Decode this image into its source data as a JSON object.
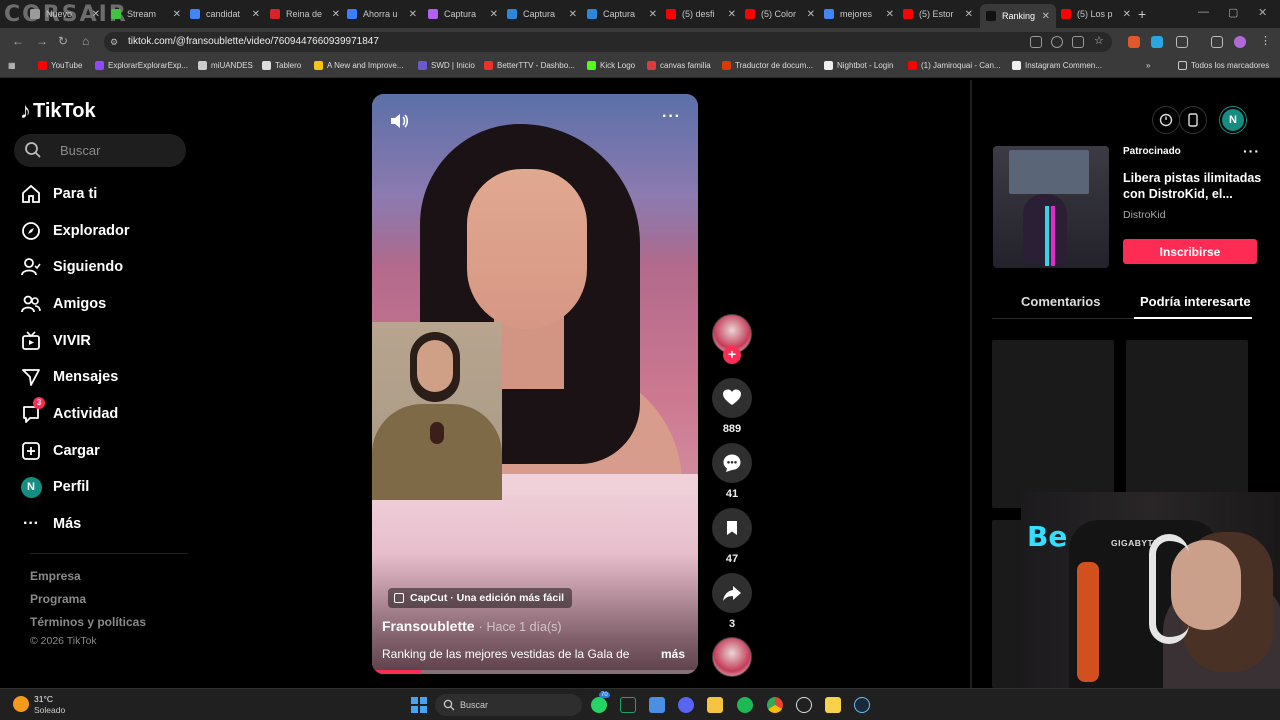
{
  "browser": {
    "watermark": "CORSAIR",
    "tabs": [
      {
        "title": "Nuevo",
        "color": "#9b9b9b"
      },
      {
        "title": "Stream",
        "color": "#3ec43e"
      },
      {
        "title": "candidat",
        "color": "#4285f4"
      },
      {
        "title": "Reina de",
        "color": "#d8232a"
      },
      {
        "title": "Ahorra u",
        "color": "#3d7eff"
      },
      {
        "title": "Captura",
        "color": "#b061f0"
      },
      {
        "title": "Captura",
        "color": "#2b88d8"
      },
      {
        "title": "Captura",
        "color": "#2b88d8"
      },
      {
        "title": "(5) desfi",
        "color": "#ff0000"
      },
      {
        "title": "(5) Color",
        "color": "#ff0000"
      },
      {
        "title": "mejores",
        "color": "#4285f4"
      },
      {
        "title": "(5) Estor",
        "color": "#ff0000"
      },
      {
        "title": "Ranking",
        "color": "#111111"
      },
      {
        "title": "(5) Los p",
        "color": "#ff0000"
      }
    ],
    "new_tab": "+",
    "url": "tiktok.com/@fransoublette/video/7609447660939971847",
    "bookmarks": [
      {
        "label": "YouTube",
        "color": "#ff0000"
      },
      {
        "label": "ExplorarExplorarExp...",
        "color": "#9146ff"
      },
      {
        "label": "miUANDES",
        "color": "#cccccc"
      },
      {
        "label": "Tablero",
        "color": "#dddddd"
      },
      {
        "label": "A New and Improve...",
        "color": "#f5c518"
      },
      {
        "label": "SWD | Inicio",
        "color": "#6a5acd"
      },
      {
        "label": "BetterTTV - Dashbo...",
        "color": "#e8322b"
      },
      {
        "label": "Kick Logo",
        "color": "#53fc18"
      },
      {
        "label": "canvas familia",
        "color": "#e03b3b"
      },
      {
        "label": "Traductor de docum...",
        "color": "#d83b01"
      },
      {
        "label": "Nightbot - Login",
        "color": "#eeeeee"
      },
      {
        "label": "(1) Jamiroquai - Can...",
        "color": "#ff0000"
      },
      {
        "label": "Instagram Commen...",
        "color": "#eeeeee"
      }
    ],
    "bookmarks_overflow": "»",
    "all_bookmarks": "Todos los marcadores"
  },
  "sidebar": {
    "logo": "TikTok",
    "search_placeholder": "Buscar",
    "items": [
      {
        "label": "Para ti",
        "icon": "home-icon"
      },
      {
        "label": "Explorador",
        "icon": "compass-icon"
      },
      {
        "label": "Siguiendo",
        "icon": "following-icon"
      },
      {
        "label": "Amigos",
        "icon": "friends-icon"
      },
      {
        "label": "VIVIR",
        "icon": "live-tv-icon"
      },
      {
        "label": "Mensajes",
        "icon": "send-icon"
      },
      {
        "label": "Actividad",
        "icon": "activity-icon",
        "badge": "3"
      },
      {
        "label": "Cargar",
        "icon": "upload-icon"
      },
      {
        "label": "Perfil",
        "icon": "profile-avatar",
        "avatar_letter": "N"
      },
      {
        "label": "Más",
        "icon": "more-dots-icon"
      }
    ],
    "footer": {
      "company": "Empresa",
      "program": "Programa",
      "terms": "Términos y políticas",
      "copyright": "© 2026 TikTok"
    }
  },
  "video": {
    "capcut": "CapCut · Una edición más fácil",
    "author": "Fransoublette",
    "separator": "·",
    "time": "Hace 1 día(s)",
    "description": "Ranking de las mejores vestidas de la Gala de",
    "more": "más",
    "progress_fraction": 0.15
  },
  "actions": {
    "likes": "889",
    "comments": "41",
    "saves": "47",
    "shares": "3"
  },
  "right_panel": {
    "user_avatar_letter": "N",
    "ad": {
      "sponsored": "Patrocinado",
      "title": "Libera pistas ilimitadas con DistroKid, el...",
      "brand": "DistroKid",
      "cta": "Inscribirse"
    },
    "tabs": {
      "comments": "Comentarios",
      "might_like": "Podría interesarte"
    }
  },
  "webcam": {
    "neon_text": "Be",
    "chair_brand": "GIGABYTE"
  },
  "taskbar": {
    "temp": "31°C",
    "weather": "Soleado",
    "search": "Buscar",
    "notification_badge": "70"
  },
  "colors": {
    "accent": "#fe2c55",
    "avatar_teal": "#168d82",
    "background": "#000000"
  }
}
